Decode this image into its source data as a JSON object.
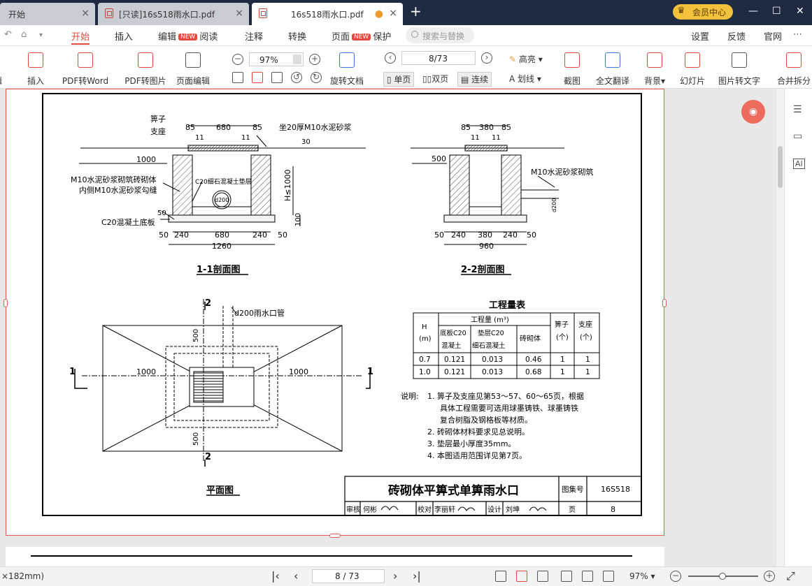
{
  "tabs": [
    {
      "label": "开始",
      "active": false
    },
    {
      "label": "[只读]16s518雨水口.pdf",
      "active": false
    },
    {
      "label": "16s518雨水口.pdf",
      "active": true
    }
  ],
  "vip_label": "会员中心",
  "menu": {
    "items": [
      "开始",
      "插入",
      "编辑",
      "阅读",
      "注释",
      "转换",
      "页面",
      "保护"
    ],
    "new_badge": "NEW",
    "search_placeholder": "搜索与替换",
    "right_items": [
      "设置",
      "反馈",
      "官网"
    ]
  },
  "toolbar": {
    "left_cut": "辑",
    "insert": "插入",
    "pdf_to_word": "PDF转Word",
    "pdf_to_image": "PDF转图片",
    "page_edit": "页面编辑",
    "zoom": "97%",
    "rotate": "旋转文档",
    "page": "8/73",
    "single": "单页",
    "double": "双页",
    "continuous": "连续",
    "highlight": "高亮",
    "strike": "划线",
    "screenshot": "截图",
    "translate": "全文翻译",
    "background": "背景",
    "slideshow": "幻灯片",
    "img_to_text": "图片转文字",
    "merge": "合并拆分"
  },
  "drawing": {
    "sec11": {
      "title": "1-1剖面图",
      "grate": "箅子",
      "seat": "支座",
      "top_dims": [
        "85",
        "680",
        "85"
      ],
      "small_dims": [
        "11",
        "11"
      ],
      "mortar_top": "坐20厚M10水泥砂浆",
      "dim30": "30",
      "left1000": "1000",
      "masonry": "M10水泥砂浆砌筑砖砌体",
      "inner": "内侧M10水泥砂浆勾缝",
      "fill": "C20细石混凝土垫层",
      "pipe": "d200",
      "height": "H≤1000",
      "d50": "50",
      "d100": "100",
      "base": "C20混凝土底板",
      "bottom_dims": [
        "50",
        "240",
        "680",
        "240",
        "50"
      ],
      "total": "1260"
    },
    "sec22": {
      "title": "2-2剖面图",
      "top_dims": [
        "85",
        "380",
        "85"
      ],
      "small_dims": [
        "11",
        "11"
      ],
      "left500": "500",
      "mortar": "M10水泥砂浆砌筑",
      "pipe": "d200",
      "bottom_dims": [
        "50",
        "240",
        "380",
        "240",
        "50"
      ],
      "total": "960"
    },
    "plan": {
      "title": "平面图",
      "pipe": "d200雨水口管",
      "mark2": "2",
      "mark1": "1",
      "d1000l": "1000",
      "d1000r": "1000",
      "d500t": "500",
      "d500b": "500"
    },
    "table": {
      "title": "工程量表",
      "qty_header": "工程量 (m³)",
      "h_header": "H\n(m)",
      "cols": [
        "底板C20\n混凝土",
        "垫层C20\n细石混凝土",
        "砖砌体"
      ],
      "grate": "箅子\n(个)",
      "seat": "支座\n(个)",
      "rows": [
        [
          "0.7",
          "0.121",
          "0.013",
          "0.46",
          "1",
          "1"
        ],
        [
          "1.0",
          "0.121",
          "0.013",
          "0.68",
          "1",
          "1"
        ]
      ]
    },
    "notes": {
      "label": "说明:",
      "items": [
        "1. 箅子及支座见第53～57、60～65页，根据",
        "具体工程需要可选用球墨铸铁、球墨铸铁",
        "复合树脂及钢格板等材质。",
        "2. 砖砌体材料要求见总说明。",
        "3. 垫层最小厚度35mm。",
        "4. 本图适用范围详见第7页。"
      ]
    },
    "titleblock": {
      "title": "砖砌体平箅式单箅雨水口",
      "atlas_label": "图集号",
      "atlas": "16S518",
      "review": "审核",
      "reviewer": "何彬",
      "check": "校对",
      "checker": "李丽轩",
      "design": "设计",
      "designer": "刘坤",
      "page_label": "页",
      "page": "8"
    }
  },
  "status": {
    "left": "×182mm)",
    "page": "8 / 73",
    "zoom": "97%"
  },
  "colors": {
    "accent": "#e2483d",
    "tabbar": "#1f2b43"
  }
}
